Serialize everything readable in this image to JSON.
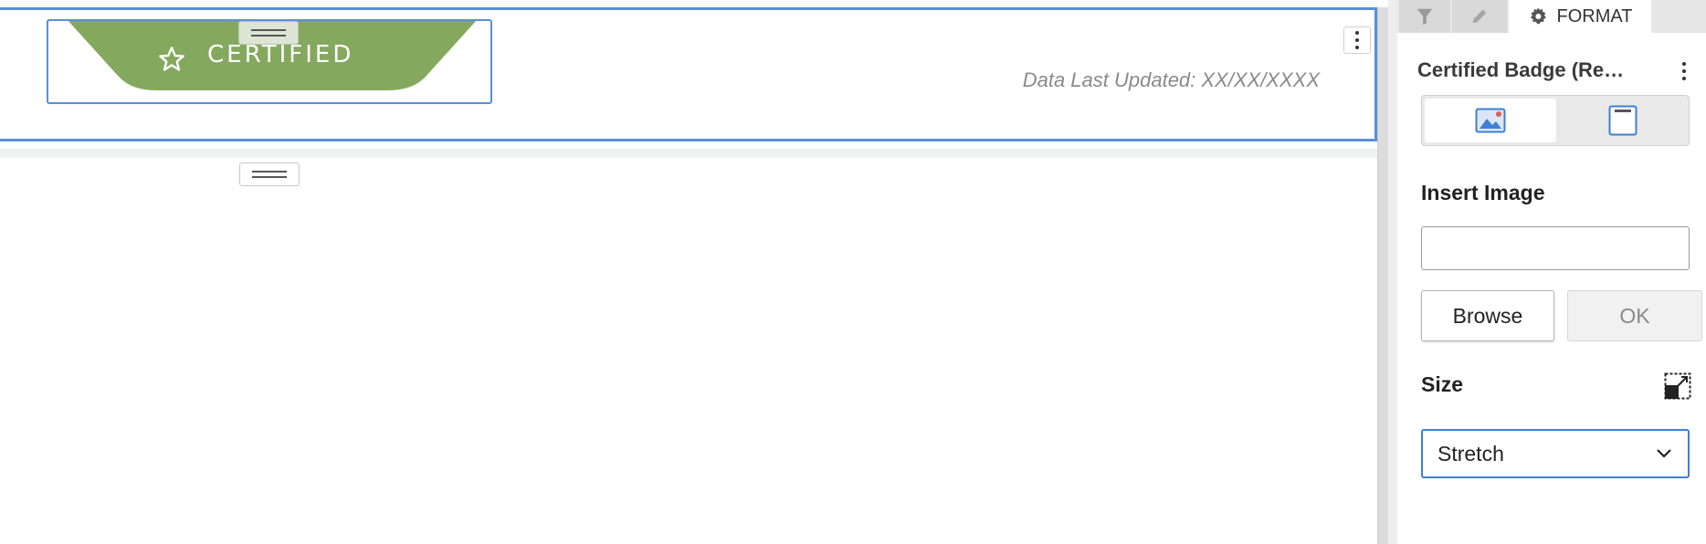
{
  "canvas": {
    "badge": {
      "label": "CERTIFIED",
      "color": "#84a95e"
    },
    "data_last_updated": "Data Last Updated: XX/XX/XXXX"
  },
  "panel": {
    "tabs": [
      {
        "name": "filter",
        "icon": "filter-icon"
      },
      {
        "name": "edit",
        "icon": "pencil-icon"
      },
      {
        "name": "format",
        "label": "FORMAT",
        "icon": "gear-icon"
      }
    ],
    "title": "Certified Badge (Re…",
    "type_options": [
      {
        "icon": "image-icon",
        "selected": true
      },
      {
        "icon": "container-icon",
        "selected": false
      }
    ],
    "insert_image": {
      "label": "Insert Image",
      "url_value": "",
      "browse_label": "Browse",
      "ok_label": "OK"
    },
    "size": {
      "label": "Size",
      "selected": "Stretch"
    }
  },
  "colors": {
    "accent": "#3f7fd6",
    "badge_green": "#84a95e"
  }
}
